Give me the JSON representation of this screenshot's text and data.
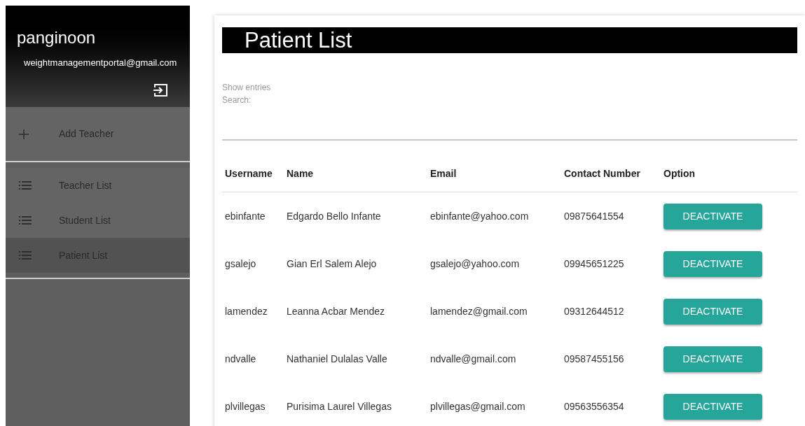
{
  "sidebar": {
    "user": {
      "name": "panginoon",
      "email": "weightmanagementportal@gmail.com"
    },
    "items": [
      {
        "label": "Add Teacher",
        "kind": "add",
        "selected": false
      },
      {
        "label": "Teacher List",
        "kind": "list",
        "selected": false
      },
      {
        "label": "Student List",
        "kind": "list",
        "selected": false
      },
      {
        "label": "Patient List",
        "kind": "list",
        "selected": true
      }
    ]
  },
  "main": {
    "title": "Patient List",
    "show_entries": "Show entries",
    "search_label": "Search:",
    "table": {
      "columns": [
        "Username",
        "Name",
        "Email",
        "Contact Number",
        "Option"
      ],
      "rows": [
        {
          "cells": [
            "ebinfante",
            "Edgardo Bello Infante",
            "ebinfante@yahoo.com",
            "09875641554"
          ],
          "button": "DEACTIVATE"
        },
        {
          "cells": [
            "gsalejo",
            "Gian Erl Salem Alejo",
            "gsalejo@yahoo.com",
            "09945651225"
          ],
          "button": "DEACTIVATE"
        },
        {
          "cells": [
            "lamendez",
            "Leanna Acbar Mendez",
            "lamendez@gmail.com",
            "09312644512"
          ],
          "button": "DEACTIVATE"
        },
        {
          "cells": [
            "ndvalle",
            "Nathaniel Dulalas Valle",
            "ndvalle@gmail.com",
            "09587455156"
          ],
          "button": "DEACTIVATE"
        },
        {
          "cells": [
            "plvillegas",
            "Purisima Laurel Villegas",
            "plvillegas@gmail.com",
            "09563556354"
          ],
          "button": "DEACTIVATE"
        }
      ]
    }
  }
}
